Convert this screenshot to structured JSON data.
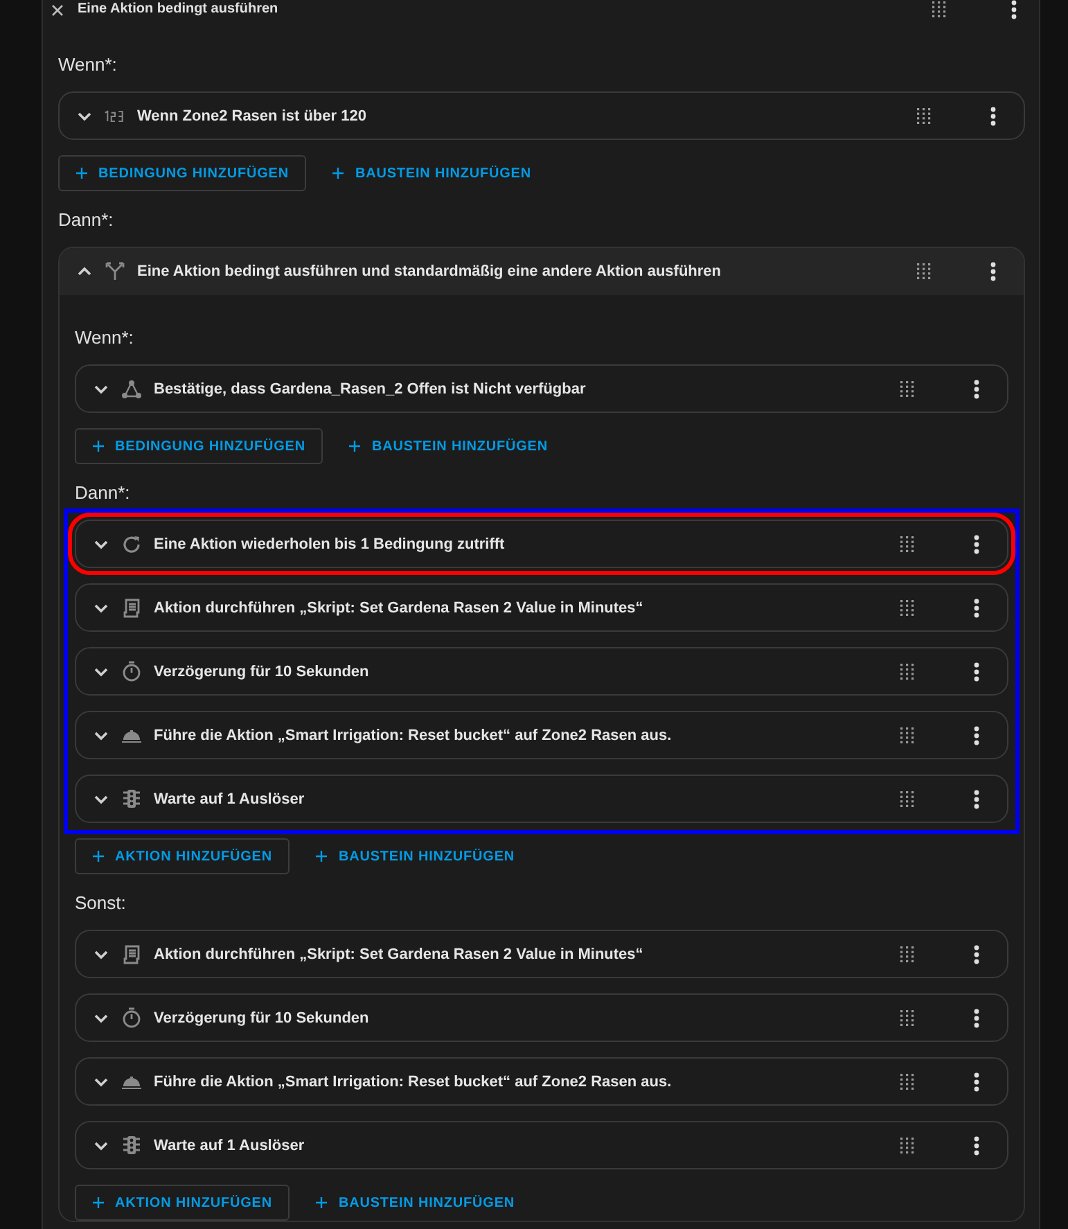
{
  "header": {
    "title": "Eine Aktion bedingt ausführen"
  },
  "if_label": "Wenn*:",
  "if_rows": [
    {
      "kind": "number",
      "text": "Wenn Zone2 Rasen ist über 120",
      "expanded": false,
      "marked": false
    }
  ],
  "if_buttons": [
    {
      "kind": "outlined",
      "label": "BEDINGUNG HINZUFÜGEN"
    },
    {
      "kind": "text",
      "label": "BAUSTEIN HINZUFÜGEN"
    }
  ],
  "then_label": "Dann*:",
  "then_block": {
    "kind": "branch",
    "text": "Eine Aktion bedingt ausführen und standardmäßig eine andere Aktion ausführen",
    "expanded": true,
    "if_label": "Wenn*:",
    "if_rows": [
      {
        "kind": "state",
        "text": "Bestätige, dass Gardena_Rasen_2 Offen ist Nicht verfügbar",
        "expanded": false,
        "marked": false
      }
    ],
    "if_buttons": [
      {
        "kind": "outlined",
        "label": "BEDINGUNG HINZUFÜGEN"
      },
      {
        "kind": "text",
        "label": "BAUSTEIN HINZUFÜGEN"
      }
    ],
    "then_label": "Dann*:",
    "then_marked": true,
    "then_rows": [
      {
        "kind": "repeat",
        "text": "Eine Aktion wiederholen bis 1 Bedingung zutrifft",
        "expanded": false,
        "marked": true
      },
      {
        "kind": "script",
        "text": "Aktion durchführen „Skript: Set Gardena Rasen 2 Value in Minutes“",
        "expanded": false,
        "marked": false
      },
      {
        "kind": "timer",
        "text": "Verzögerung für 10 Sekunden",
        "expanded": false,
        "marked": false
      },
      {
        "kind": "service",
        "text": "Führe die Aktion „Smart Irrigation: Reset bucket“ auf Zone2 Rasen aus.",
        "expanded": false,
        "marked": false
      },
      {
        "kind": "wait",
        "text": "Warte auf 1 Auslöser",
        "expanded": false,
        "marked": false
      }
    ],
    "then_buttons": [
      {
        "kind": "outlined",
        "label": "AKTION HINZUFÜGEN"
      },
      {
        "kind": "text",
        "label": "BAUSTEIN HINZUFÜGEN"
      }
    ],
    "else_label": "Sonst:",
    "else_rows": [
      {
        "kind": "script",
        "text": "Aktion durchführen „Skript: Set Gardena Rasen 2 Value in Minutes“",
        "expanded": false,
        "marked": false
      },
      {
        "kind": "timer",
        "text": "Verzögerung für 10 Sekunden",
        "expanded": false,
        "marked": false
      },
      {
        "kind": "service",
        "text": "Führe die Aktion „Smart Irrigation: Reset bucket“ auf Zone2 Rasen aus.",
        "expanded": false,
        "marked": false
      },
      {
        "kind": "wait",
        "text": "Warte auf 1 Auslöser",
        "expanded": false,
        "marked": false
      }
    ],
    "else_buttons": [
      {
        "kind": "outlined",
        "label": "AKTION HINZUFÜGEN"
      },
      {
        "kind": "text",
        "label": "BAUSTEIN HINZUFÜGEN"
      }
    ]
  }
}
